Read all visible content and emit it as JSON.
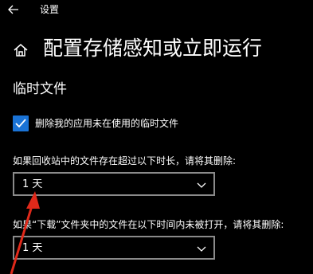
{
  "window": {
    "title": "设置"
  },
  "page": {
    "title": "配置存储感知或立即运行"
  },
  "section": {
    "title": "临时文件"
  },
  "checkbox": {
    "label": "删除我的应用未在使用的临时文件",
    "checked": true
  },
  "recycle_bin": {
    "label": "如果回收站中的文件存在超过以下时长，请将其删除:",
    "value": "1 天"
  },
  "downloads": {
    "label": "如果“下载”文件夹中的文件在以下时间内未被打开，请将其删除:",
    "value": "1 天"
  },
  "colors": {
    "accent": "#1a73d6",
    "annotation": "#e0291a",
    "background": "#000000"
  },
  "icons": [
    "back-arrow-icon",
    "home-icon",
    "checkmark-icon",
    "chevron-down-icon"
  ]
}
